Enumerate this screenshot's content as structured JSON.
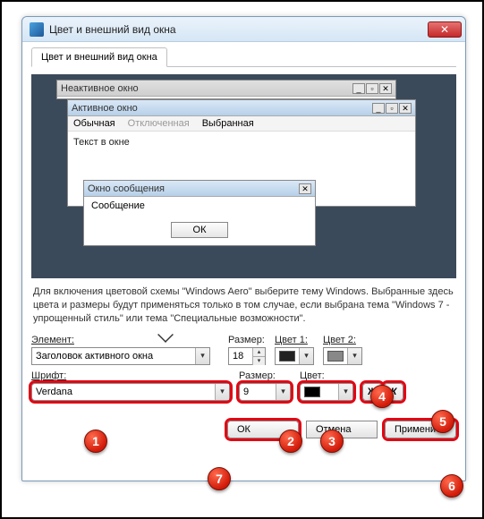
{
  "window": {
    "title": "Цвет и внешний вид окна",
    "tab": "Цвет и внешний вид окна",
    "close_glyph": "✕"
  },
  "preview": {
    "inactive_title": "Неактивное окно",
    "active_title": "Активное окно",
    "menu": {
      "normal": "Обычная",
      "disabled": "Отключенная",
      "selected": "Выбранная"
    },
    "text_in_window": "Текст в окне",
    "msg_title": "Окно сообщения",
    "msg_body": "Сообщение",
    "ok": "ОК",
    "winbtns": {
      "min": "_",
      "max": "▫",
      "close": "✕"
    }
  },
  "description": "Для включения цветовой схемы \"Windows Aero\" выберите тему Windows. Выбранные здесь цвета и размеры будут применяться только в том случае, если выбрана тема \"Windows 7 - упрощенный стиль\" или тема \"Специальные возможности\".",
  "row1": {
    "element_label": "Элемент:",
    "element_value": "Заголовок активного окна",
    "size_label": "Размер:",
    "size_value": "18",
    "color1_label": "Цвет 1:",
    "color2_label": "Цвет 2:"
  },
  "row2": {
    "font_label": "Шрифт:",
    "font_value": "Verdana",
    "size_label": "Размер:",
    "size_value": "9",
    "color_label": "Цвет:",
    "bold": "Ж",
    "italic": "К"
  },
  "buttons": {
    "ok": "ОК",
    "cancel": "Отмена",
    "apply": "Применить"
  },
  "markers": {
    "m1": "1",
    "m2": "2",
    "m3": "3",
    "m4": "4",
    "m5": "5",
    "m6": "6",
    "m7": "7"
  },
  "dropdown_glyph": "▾"
}
